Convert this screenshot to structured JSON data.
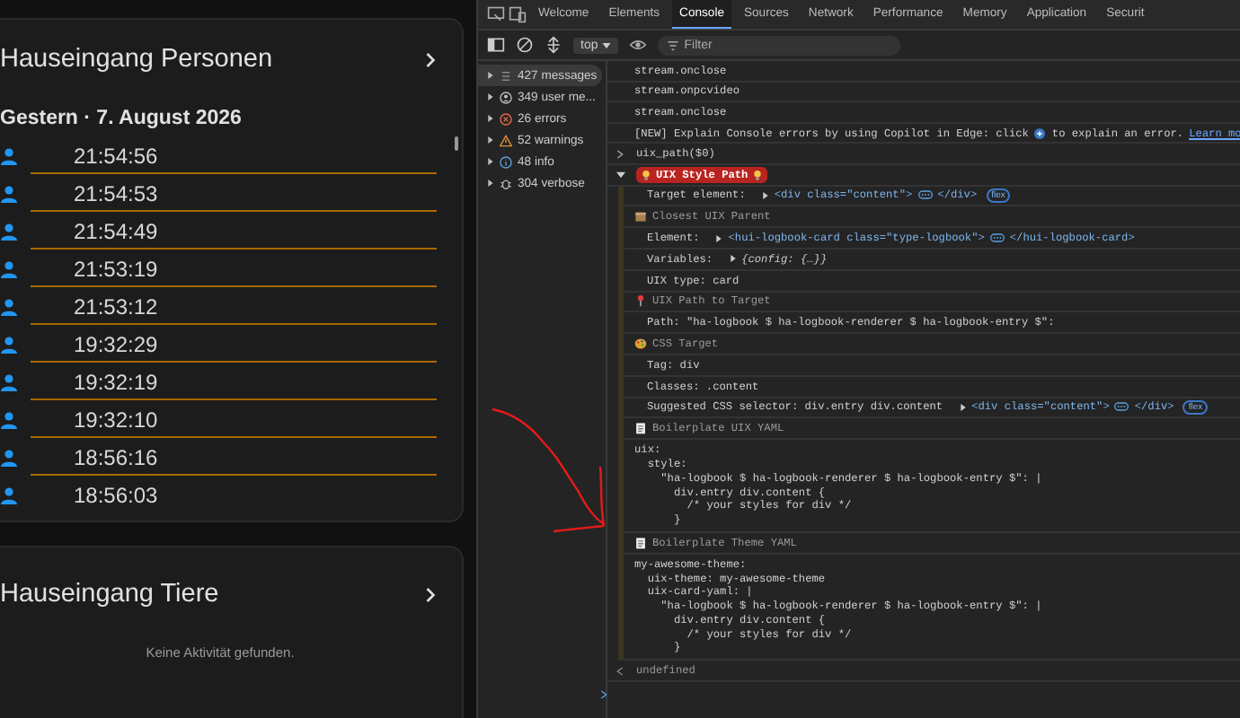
{
  "cards": [
    {
      "kind": "logbook",
      "title": "Hauseingang Personen",
      "date": "Gestern · 7. August 2026",
      "entries": [
        "21:54:56",
        "21:54:53",
        "21:54:49",
        "21:53:19",
        "21:53:12",
        "19:32:29",
        "19:32:19",
        "19:32:10",
        "18:56:16",
        "18:56:03"
      ]
    },
    {
      "kind": "empty",
      "title": "Hauseingang Tiere",
      "message": "Keine Aktivität gefunden."
    }
  ],
  "devtools": {
    "tabs": [
      {
        "label": "Welcome",
        "selected": false
      },
      {
        "label": "Elements",
        "selected": false
      },
      {
        "label": "Console",
        "selected": true
      },
      {
        "label": "Sources",
        "selected": false
      },
      {
        "label": "Network",
        "selected": false
      },
      {
        "label": "Performance",
        "selected": false
      },
      {
        "label": "Memory",
        "selected": false
      },
      {
        "label": "Application",
        "selected": false
      },
      {
        "label": "Securit",
        "selected": false
      }
    ],
    "context": "top",
    "filter": {
      "placeholder": "Filter"
    },
    "sidebar": [
      {
        "kind": "messages",
        "label": "427 messages",
        "selected": true
      },
      {
        "kind": "user",
        "label": "349 user me...",
        "selected": false
      },
      {
        "kind": "errors",
        "label": "26 errors",
        "selected": false
      },
      {
        "kind": "warnings",
        "label": "52 warnings",
        "selected": false
      },
      {
        "kind": "info",
        "label": "48 info",
        "selected": false
      },
      {
        "kind": "verbose",
        "label": "304 verbose",
        "selected": false
      }
    ],
    "console": [
      {
        "kind": "log",
        "text": "stream.onclose"
      },
      {
        "kind": "log",
        "text": "stream.onpcvideo"
      },
      {
        "kind": "log",
        "text": "stream.onclose"
      },
      {
        "kind": "notice",
        "text": "[NEW] Explain Console errors by using Copilot in Edge: click",
        "after": "to explain an error.",
        "link": "Learn mo"
      },
      {
        "kind": "input",
        "text": "uix_path($0)"
      },
      {
        "kind": "group",
        "text": "UIX Style Path",
        "expanded": true,
        "children": [
          {
            "kind": "element",
            "label": "Target element:",
            "open": "<div class=\"content\">",
            "close": "</div>",
            "tag": "flex"
          },
          {
            "kind": "section",
            "title": "Closest UIX Parent",
            "children": [
              {
                "kind": "element",
                "label": "Element:",
                "open": "<hui-logbook-card class=\"type-logbook\">",
                "close": "</hui-logbook-card>"
              },
              {
                "kind": "object",
                "label": "Variables:",
                "value": "{config: {…}}"
              },
              {
                "kind": "text",
                "text": "UIX type: card"
              }
            ]
          },
          {
            "kind": "section",
            "title": "UIX Path to Target",
            "children": [
              {
                "kind": "text",
                "text": "Path: \"ha-logbook $ ha-logbook-renderer $ ha-logbook-entry $\":"
              }
            ]
          },
          {
            "kind": "section",
            "title": "CSS Target",
            "children": [
              {
                "kind": "text",
                "text": "Tag: div"
              },
              {
                "kind": "text",
                "text": "Classes: .content"
              },
              {
                "kind": "element",
                "label": "Suggested CSS selector: div.entry div.content",
                "open": "<div class=\"content\">",
                "close": "</div>",
                "tag": "flex"
              }
            ]
          },
          {
            "kind": "section",
            "title": "Boilerplate UIX YAML",
            "children": [
              {
                "kind": "code",
                "lines": [
                  "uix:",
                  "  style:",
                  "    \"ha-logbook $ ha-logbook-renderer $ ha-logbook-entry $\": |",
                  "      div.entry div.content {",
                  "        /* your styles for div */",
                  "      }"
                ]
              }
            ]
          },
          {
            "kind": "section",
            "title": "Boilerplate Theme YAML",
            "children": [
              {
                "kind": "code",
                "lines": [
                  "my-awesome-theme:",
                  "  uix-theme: my-awesome-theme",
                  "  uix-card-yaml: |",
                  "    \"ha-logbook $ ha-logbook-renderer $ ha-logbook-entry $\": |",
                  "      div.entry div.content {",
                  "        /* your styles for div */",
                  "      }"
                ]
              }
            ]
          }
        ]
      },
      {
        "kind": "result",
        "text": "undefined"
      },
      {
        "kind": "prompt"
      }
    ]
  }
}
